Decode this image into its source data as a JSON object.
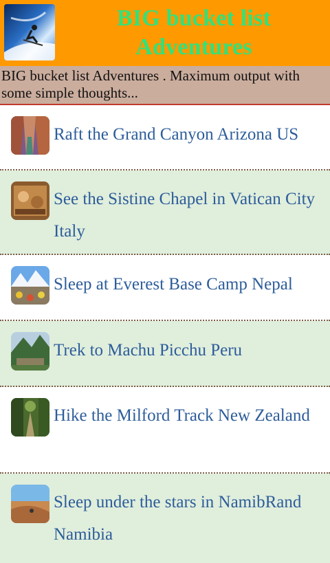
{
  "header": {
    "title": "BIG bucket list Adventures",
    "logo_icon": "skier-logo-icon",
    "background_color": "#ff9900",
    "title_color": "#33e07a"
  },
  "subtitle": {
    "text": "BIG bucket list Adventures . Maximum output with some simple thoughts..."
  },
  "list": {
    "items": [
      {
        "label": "Raft the Grand Canyon Arizona US",
        "thumbnail": "grand-canyon-thumbnail"
      },
      {
        "label": "See the Sistine Chapel in Vatican City Italy",
        "thumbnail": "sistine-chapel-thumbnail"
      },
      {
        "label": "Sleep at Everest Base Camp Nepal",
        "thumbnail": "everest-base-camp-thumbnail"
      },
      {
        "label": "Trek to Machu Picchu Peru",
        "thumbnail": "machu-picchu-thumbnail"
      },
      {
        "label": "Hike the Milford Track New Zealand",
        "thumbnail": "milford-track-thumbnail"
      },
      {
        "label": "Sleep under the stars in NamibRand Namibia",
        "thumbnail": "namibrand-thumbnail"
      }
    ]
  },
  "colors": {
    "item_text": "#2d5d9a",
    "alt_row": "#e0eedc",
    "subtitle_bg": "#cbad9d"
  }
}
